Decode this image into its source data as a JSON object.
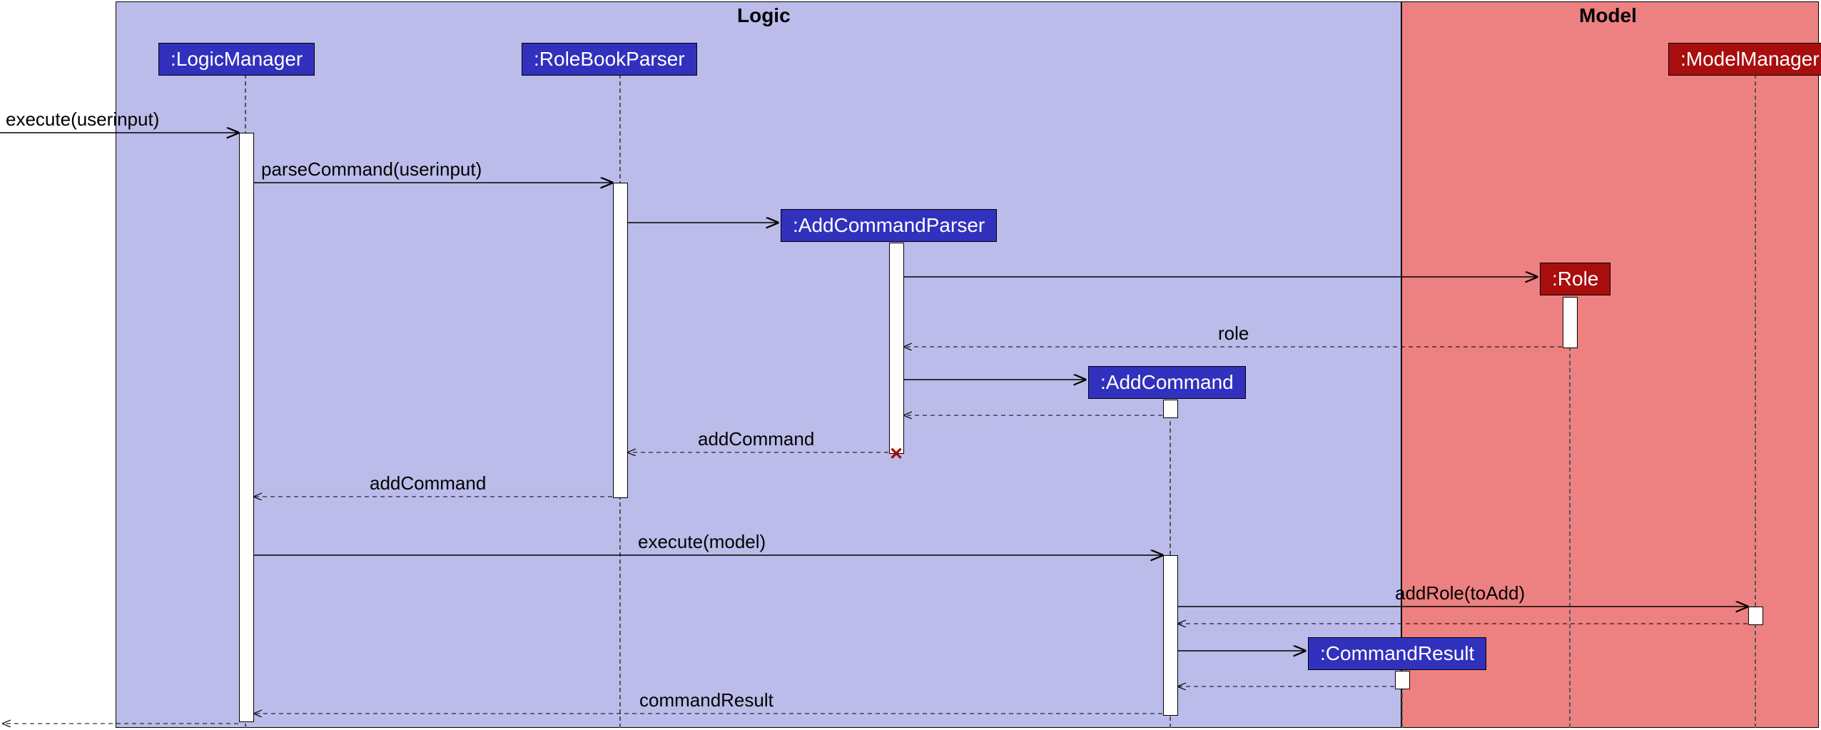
{
  "regions": {
    "logic": {
      "title": "Logic"
    },
    "model": {
      "title": "Model"
    }
  },
  "participants": {
    "logicManager": ":LogicManager",
    "roleBookParser": ":RoleBookParser",
    "addCommandParser": ":AddCommandParser",
    "role": ":Role",
    "addCommand": ":AddCommand",
    "commandResult": ":CommandResult",
    "modelManager": ":ModelManager"
  },
  "messages": {
    "executeUserInput": "execute(userinput)",
    "parseCommand": "parseCommand(userinput)",
    "roleReturn": "role",
    "addCommandReturn1": "addCommand",
    "addCommandReturn2": "addCommand",
    "executeModel": "execute(model)",
    "addRole": "addRole(toAdd)",
    "commandResultReturn": "commandResult"
  }
}
